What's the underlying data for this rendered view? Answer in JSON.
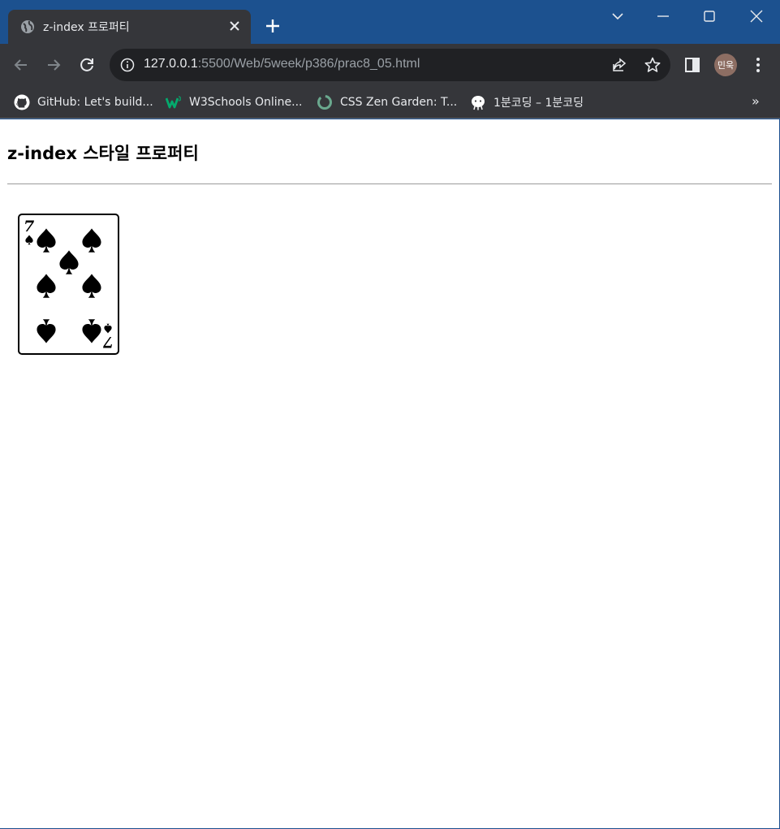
{
  "browser": {
    "tab": {
      "title": "z-index 프로퍼티"
    },
    "address": {
      "host": "127.0.0.1",
      "path": ":5500/Web/5week/p386/prac8_05.html"
    },
    "profile": {
      "initials": "민욱",
      "color": "#8d6e63"
    },
    "bookmarks": [
      {
        "label": "GitHub: Let's build...",
        "icon": "github-icon"
      },
      {
        "label": "W3Schools Online...",
        "icon": "w3schools-icon"
      },
      {
        "label": "CSS Zen Garden: T...",
        "icon": "zen-garden-icon"
      },
      {
        "label": "1분코딩 – 1분코딩",
        "icon": "1min-coding-icon"
      }
    ],
    "overflow_label": "»",
    "colors": {
      "titlebar": "#1c518f",
      "toolbar": "#35363a",
      "omnibox": "#202124"
    }
  },
  "page": {
    "heading": "z-index 스타일 프로퍼티",
    "card": {
      "rank": "7",
      "suit": "spades",
      "icon": "playing-card-seven-of-spades"
    }
  }
}
